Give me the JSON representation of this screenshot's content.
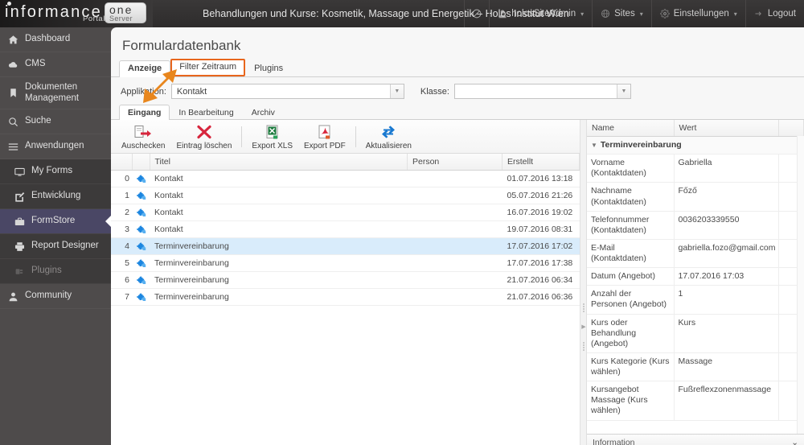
{
  "brand": {
    "name": "informance",
    "portal_label": "Portal",
    "one_label": "one",
    "server_label": "Server"
  },
  "topbar": {
    "title": "Behandlungen und Kurse: Kosmetik, Massage und Energetik – Holos Institut Wien",
    "items": [
      {
        "label": "",
        "icon": "block-icon"
      },
      {
        "label": "holosSiteAdmin",
        "icon": "user-icon",
        "caret": "▾"
      },
      {
        "label": "Sites",
        "icon": "globe-icon",
        "caret": "▾"
      },
      {
        "label": "Einstellungen",
        "icon": "gear-icon",
        "caret": "▾"
      },
      {
        "label": "Logout",
        "icon": "logout-icon"
      }
    ]
  },
  "sidebar": {
    "items": [
      {
        "label": "Dashboard",
        "icon": "home-icon",
        "state": "normal"
      },
      {
        "label": "CMS",
        "icon": "cloud-icon",
        "state": "normal"
      },
      {
        "label": "Dokumenten Management",
        "icon": "bookmark-icon",
        "state": "normal"
      },
      {
        "label": "Suche",
        "icon": "search-icon",
        "state": "normal"
      },
      {
        "label": "Anwendungen",
        "icon": "menu-icon",
        "state": "normal"
      }
    ],
    "sub_items": [
      {
        "label": "My Forms",
        "icon": "monitor-icon",
        "state": "normal"
      },
      {
        "label": "Entwicklung",
        "icon": "edit-icon",
        "state": "normal"
      },
      {
        "label": "FormStore",
        "icon": "briefcase-icon",
        "state": "active"
      },
      {
        "label": "Report Designer",
        "icon": "printer-icon",
        "state": "normal"
      },
      {
        "label": "Plugins",
        "icon": "plug-icon",
        "state": "disabled"
      }
    ],
    "footer_items": [
      {
        "label": "Community",
        "icon": "people-icon",
        "state": "normal"
      }
    ]
  },
  "page": {
    "title": "Formulardatenbank",
    "tabs": [
      {
        "label": "Anzeige",
        "selected": true,
        "highlighted": false
      },
      {
        "label": "Filter Zeitraum",
        "selected": false,
        "highlighted": true
      },
      {
        "label": "Plugins",
        "selected": false,
        "highlighted": false
      }
    ],
    "highlight_color": "#e8661d",
    "filters": {
      "applikation_label": "Applikation:",
      "applikation_value": "Kontakt",
      "klasse_label": "Klasse:",
      "klasse_value": ""
    },
    "subtabs": [
      {
        "label": "Eingang",
        "selected": true
      },
      {
        "label": "In Bearbeitung",
        "selected": false
      },
      {
        "label": "Archiv",
        "selected": false
      }
    ]
  },
  "toolbar": {
    "buttons": [
      {
        "label": "Auschecken",
        "icon": "checkout-icon"
      },
      {
        "label": "Eintrag löschen",
        "icon": "delete-x-icon"
      },
      {
        "label": "Export XLS",
        "icon": "excel-icon"
      },
      {
        "label": "Export PDF",
        "icon": "pdf-icon"
      },
      {
        "label": "Aktualisieren",
        "icon": "refresh-icon"
      }
    ]
  },
  "grid": {
    "columns": [
      "",
      "",
      "Titel",
      "",
      "Person",
      "Erstellt"
    ],
    "headers": {
      "titel": "Titel",
      "person": "Person",
      "erstellt": "Erstellt"
    },
    "rows": [
      {
        "num": "0",
        "icon": "form-entry-icon",
        "titel": "Kontakt",
        "person": "",
        "erstellt": "01.07.2016 13:18",
        "selected": false
      },
      {
        "num": "1",
        "icon": "form-entry-icon",
        "titel": "Kontakt",
        "person": "",
        "erstellt": "05.07.2016 21:26",
        "selected": false
      },
      {
        "num": "2",
        "icon": "form-entry-icon",
        "titel": "Kontakt",
        "person": "",
        "erstellt": "16.07.2016 19:02",
        "selected": false
      },
      {
        "num": "3",
        "icon": "form-entry-icon",
        "titel": "Kontakt",
        "person": "",
        "erstellt": "19.07.2016 08:31",
        "selected": false
      },
      {
        "num": "4",
        "icon": "form-entry-icon",
        "titel": "Terminvereinbarung",
        "person": "",
        "erstellt": "17.07.2016 17:02",
        "selected": true
      },
      {
        "num": "5",
        "icon": "form-entry-icon",
        "titel": "Terminvereinbarung",
        "person": "",
        "erstellt": "17.07.2016 17:38",
        "selected": false
      },
      {
        "num": "6",
        "icon": "form-entry-icon",
        "titel": "Terminvereinbarung",
        "person": "",
        "erstellt": "21.07.2016 06:34",
        "selected": false
      },
      {
        "num": "7",
        "icon": "form-entry-icon",
        "titel": "Terminvereinbarung",
        "person": "",
        "erstellt": "21.07.2016 06:36",
        "selected": false
      }
    ]
  },
  "detail": {
    "headers": {
      "name": "Name",
      "wert": "Wert"
    },
    "group_label": "Terminvereinbarung",
    "rows": [
      {
        "name": "Vorname (Kontaktdaten)",
        "wert": "Gabriella"
      },
      {
        "name": "Nachname (Kontaktdaten)",
        "wert": "Főző"
      },
      {
        "name": "Telefonnummer (Kontaktdaten)",
        "wert": "0036203339550"
      },
      {
        "name": "E-Mail (Kontaktdaten)",
        "wert": "gabriella.fozo@gmail.com"
      },
      {
        "name": "Datum (Angebot)",
        "wert": "17.07.2016 17:03"
      },
      {
        "name": "Anzahl der Personen (Angebot)",
        "wert": "1"
      },
      {
        "name": "Kurs oder Behandlung (Angebot)",
        "wert": "Kurs"
      },
      {
        "name": "Kurs Kategorie (Kurs wählen)",
        "wert": "Massage"
      },
      {
        "name": "Kursangebot Massage (Kurs wählen)",
        "wert": "Fußreflexzonenmassage"
      }
    ],
    "info_label": "Information",
    "info_caret": "⌄"
  }
}
